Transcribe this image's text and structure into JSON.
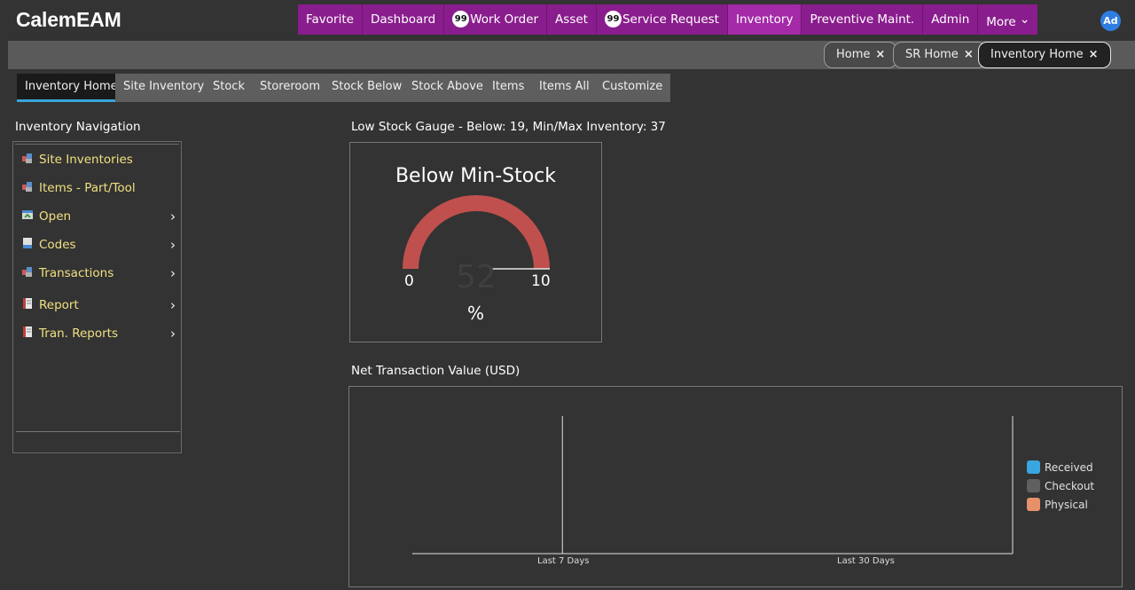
{
  "app": {
    "logo": "CalemEAM",
    "avatar_initials": "Ad"
  },
  "main_nav": [
    {
      "label": "Favorite",
      "badge": ""
    },
    {
      "label": "Dashboard",
      "badge": ""
    },
    {
      "label": "Work Order",
      "badge": "99"
    },
    {
      "label": "Asset",
      "badge": ""
    },
    {
      "label": "Service Request",
      "badge": "99"
    },
    {
      "label": "Inventory",
      "badge": "",
      "active": true
    },
    {
      "label": "Preventive Maint.",
      "badge": ""
    },
    {
      "label": "Admin",
      "badge": ""
    },
    {
      "label": "More",
      "badge": ""
    }
  ],
  "open_tabs": [
    {
      "label": "Home",
      "close": "×"
    },
    {
      "label": "SR Home",
      "close": "×"
    },
    {
      "label": "Inventory Home",
      "close": "×",
      "active": true
    }
  ],
  "sub_tabs": [
    "Inventory Home",
    "Site Inventory",
    "Stock",
    "Storeroom",
    "Stock Below",
    "Stock Above",
    "Items",
    "Items All",
    "Customize"
  ],
  "navigation": {
    "title": "Inventory Navigation",
    "items": [
      {
        "label": "Site Inventories",
        "icon": "inventory-icon",
        "has_submenu": false
      },
      {
        "label": "Items - Part/Tool",
        "icon": "inventory-icon",
        "has_submenu": false
      },
      {
        "label": "Open",
        "icon": "open-icon",
        "has_submenu": true
      },
      {
        "label": "Codes",
        "icon": "codes-icon",
        "has_submenu": true
      },
      {
        "label": "Transactions",
        "icon": "inventory-icon",
        "has_submenu": true
      },
      {
        "label": "Report",
        "icon": "report-icon",
        "has_submenu": true
      },
      {
        "label": "Tran. Reports",
        "icon": "report-icon",
        "has_submenu": true
      }
    ],
    "arrow": "›"
  },
  "gauge": {
    "section_title": "Low Stock Gauge - Below: 19, Min/Max Inventory: 37",
    "title": "Below Min-Stock",
    "min": "0",
    "max": "10",
    "value": "52",
    "unit": "%",
    "color": "#c0504d"
  },
  "chart_section_title": "Net Transaction Value (USD)",
  "chart_data": {
    "type": "bar",
    "categories": [
      "Last 7 Days",
      "Last 30 Days"
    ],
    "series": [
      {
        "name": "Received",
        "color": "#3aa6e0",
        "values": [
          0,
          0
        ]
      },
      {
        "name": "Checkout",
        "color": "#606060",
        "values": [
          0,
          0
        ]
      },
      {
        "name": "Physical",
        "color": "#e8906a",
        "values": [
          0,
          0
        ]
      }
    ],
    "legend": "right"
  }
}
